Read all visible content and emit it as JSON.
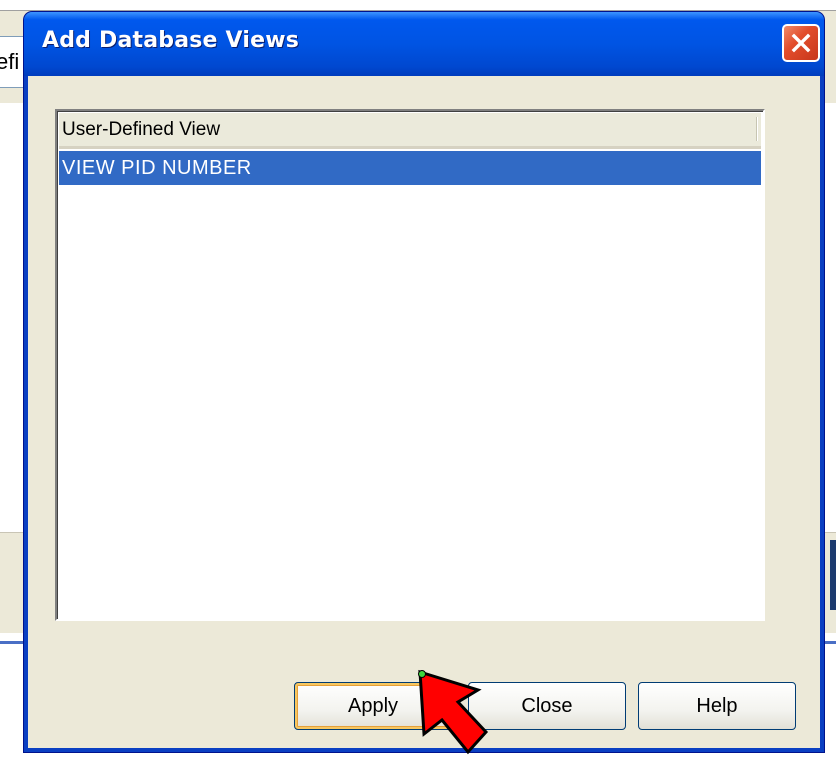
{
  "background": {
    "field_text": "efi"
  },
  "dialog": {
    "title": "Add Database Views",
    "close_icon": "close-x-icon",
    "list": {
      "columns": [
        "User-Defined View"
      ],
      "rows": [
        "VIEW PID NUMBER"
      ],
      "selected_index": 0
    },
    "buttons": {
      "apply": "Apply",
      "close": "Close",
      "help": "Help"
    }
  },
  "annotation": {
    "icon": "red-pointer-arrow-icon"
  },
  "colors": {
    "titlebar": "#0054e3",
    "selection": "#316ac5",
    "dialog_face": "#ece9d8",
    "arrow": "#ff0000"
  }
}
